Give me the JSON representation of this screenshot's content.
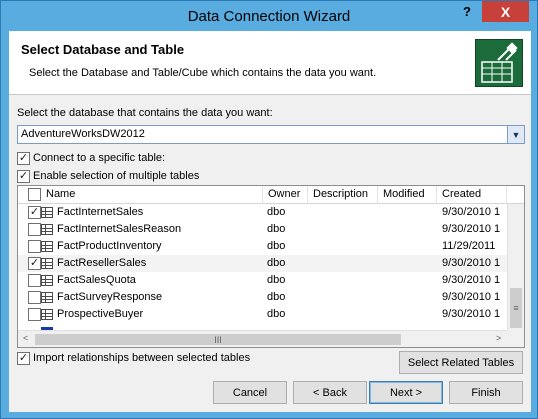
{
  "window": {
    "title": "Data Connection Wizard",
    "help_glyph": "?",
    "close_glyph": "X"
  },
  "header": {
    "title": "Select Database and Table",
    "subtitle": "Select the Database and Table/Cube which contains the data you want."
  },
  "database": {
    "label": "Select the database that contains the data you want:",
    "value": "AdventureWorksDW2012"
  },
  "options": {
    "connect_specific": {
      "label": "Connect to a specific table:",
      "checked": true
    },
    "enable_multiple": {
      "label": "Enable selection of multiple tables",
      "checked": true
    },
    "import_relationships": {
      "label": "Import relationships between selected tables",
      "checked": true
    }
  },
  "table": {
    "columns": [
      "Name",
      "Owner",
      "Description",
      "Modified",
      "Created"
    ],
    "rows": [
      {
        "name": "FactInternetSales",
        "owner": "dbo",
        "description": "",
        "modified": "",
        "created": "9/30/2010 1",
        "checked": true
      },
      {
        "name": "FactInternetSalesReason",
        "owner": "dbo",
        "description": "",
        "modified": "",
        "created": "9/30/2010 1",
        "checked": false
      },
      {
        "name": "FactProductInventory",
        "owner": "dbo",
        "description": "",
        "modified": "",
        "created": "11/29/2011",
        "checked": false
      },
      {
        "name": "FactResellerSales",
        "owner": "dbo",
        "description": "",
        "modified": "",
        "created": "9/30/2010 1",
        "checked": true
      },
      {
        "name": "FactSalesQuota",
        "owner": "dbo",
        "description": "",
        "modified": "",
        "created": "9/30/2010 1",
        "checked": false
      },
      {
        "name": "FactSurveyResponse",
        "owner": "dbo",
        "description": "",
        "modified": "",
        "created": "9/30/2010 1",
        "checked": false
      },
      {
        "name": "ProspectiveBuyer",
        "owner": "dbo",
        "description": "",
        "modified": "",
        "created": "9/30/2010 1",
        "checked": false
      }
    ]
  },
  "buttons": {
    "select_related": "Select Related Tables",
    "cancel": "Cancel",
    "back": "< Back",
    "next": "Next >",
    "finish": "Finish"
  },
  "scroll_glyphs": {
    "left": "<",
    "right": ">",
    "grip": "III",
    "vgrip": "≡"
  },
  "check_glyph": "✓",
  "icons": {
    "wizard": "database-connection-icon",
    "table": "table-icon"
  }
}
